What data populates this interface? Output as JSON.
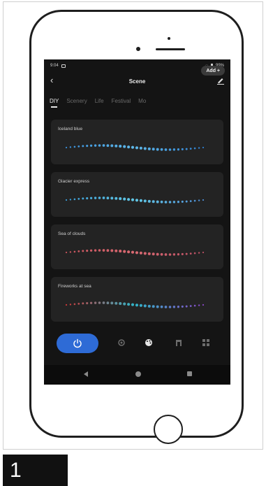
{
  "status_bar": {
    "time": "9:04",
    "battery": "99%"
  },
  "header": {
    "title": "Scene"
  },
  "tabs": [
    {
      "label": "DIY",
      "active": true
    },
    {
      "label": "Scenery",
      "active": false
    },
    {
      "label": "Life",
      "active": false
    },
    {
      "label": "Festival",
      "active": false
    },
    {
      "label": "Mo",
      "active": false
    }
  ],
  "add_button": {
    "label": "Add +"
  },
  "scenes": [
    {
      "name": "Iceland blue",
      "colors": [
        "#3a8fd8",
        "#5fb8e8",
        "#2f7fcf"
      ]
    },
    {
      "name": "Glacier express",
      "colors": [
        "#3b9ed8",
        "#62c7e4",
        "#4f8fd6"
      ]
    },
    {
      "name": "Sea of clouds",
      "colors": [
        "#c9545d",
        "#d86a72",
        "#b94f63"
      ]
    },
    {
      "name": "Fireworks at sea",
      "colors": [
        "#d23a3a",
        "#2fb5c8",
        "#8a48c8"
      ]
    }
  ],
  "step": {
    "number": "1"
  },
  "colors": {
    "accent": "#2e6bd6",
    "screen_bg": "#141414",
    "card_bg": "#232323"
  },
  "icons": {
    "back": "chevron-left-icon",
    "edit": "edit-icon",
    "power": "power-icon",
    "nav": [
      "sun-icon",
      "palette-icon",
      "music-icon",
      "grid-icon"
    ]
  }
}
